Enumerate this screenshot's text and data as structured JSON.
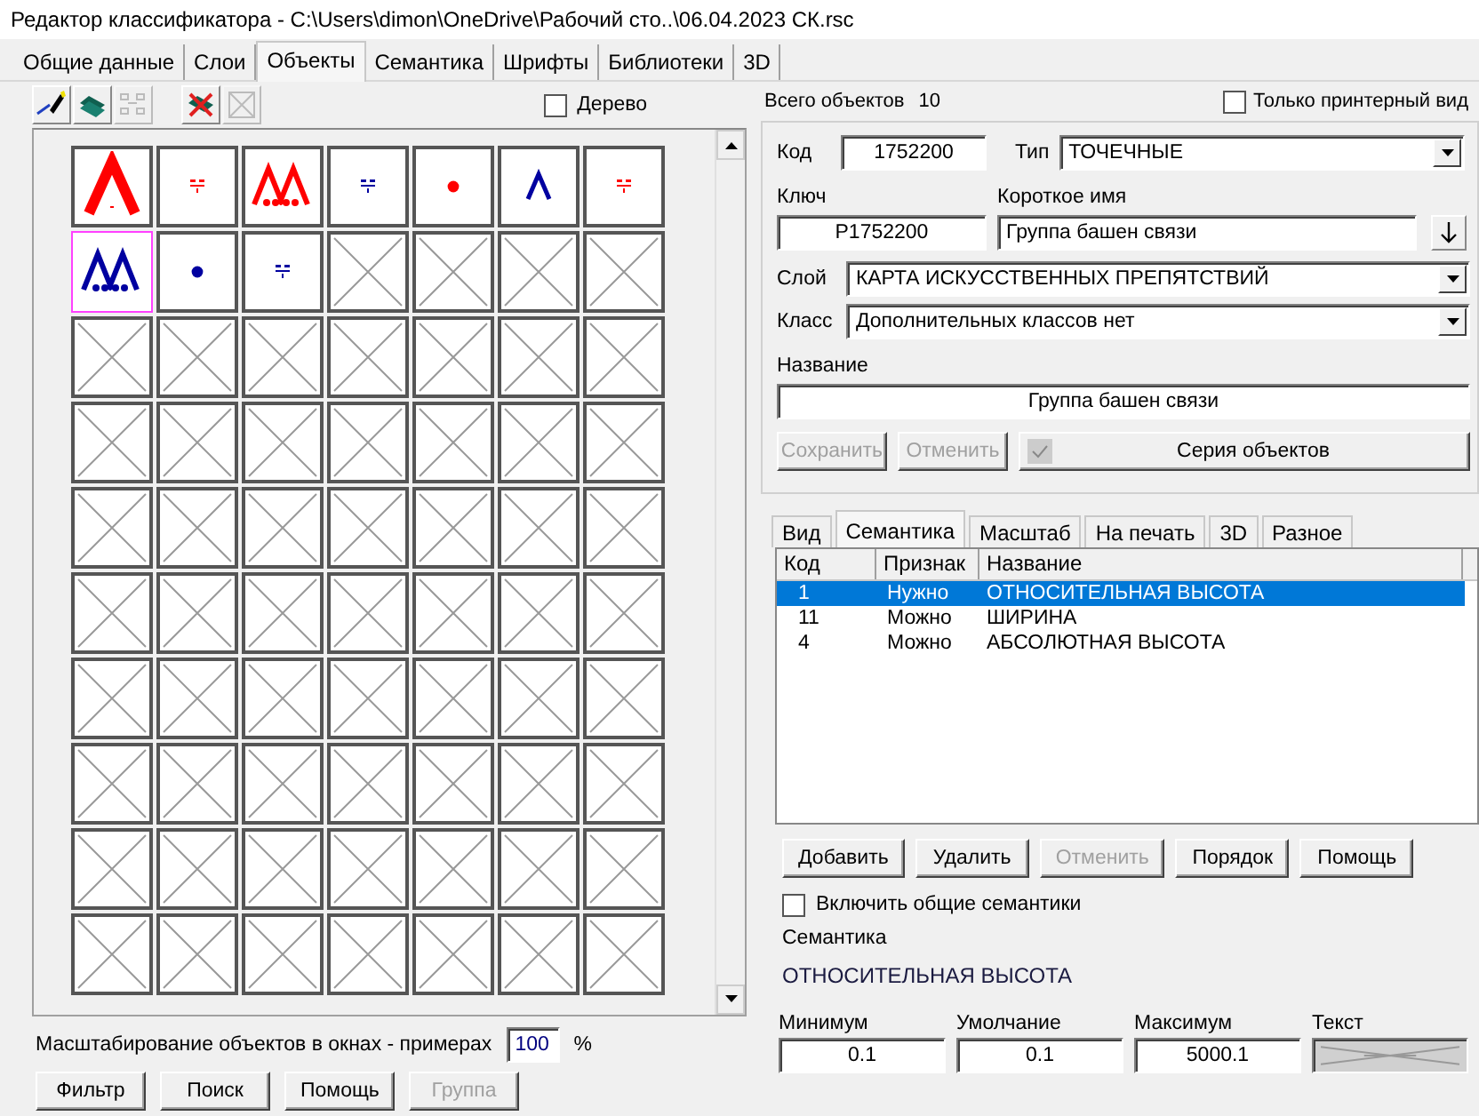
{
  "window": {
    "title": "Редактор классификатора - C:\\Users\\dimon\\OneDrive\\Рабочий сто..\\06.04.2023 СК.rsc"
  },
  "tabs": [
    {
      "label": "Общие данные",
      "selected": false
    },
    {
      "label": "Слои",
      "selected": false
    },
    {
      "label": "Объекты",
      "selected": true
    },
    {
      "label": "Семантика",
      "selected": false
    },
    {
      "label": "Шрифты",
      "selected": false
    },
    {
      "label": "Библиотеки",
      "selected": false
    },
    {
      "label": "3D",
      "selected": false
    }
  ],
  "toolbar": [
    {
      "kind": "edit",
      "disabled": false
    },
    {
      "kind": "copy",
      "disabled": false
    },
    {
      "kind": "move",
      "disabled": true
    },
    {
      "kind": "delete",
      "disabled": false
    },
    {
      "kind": "clear",
      "disabled": true
    }
  ],
  "tree_checkbox": {
    "label": "Дерево",
    "checked": false
  },
  "objects": [
    {
      "kind": "caret",
      "color": "#ff0000",
      "selected": false
    },
    {
      "kind": "fraction",
      "color": "#ff0000",
      "selected": false
    },
    {
      "kind": "double",
      "color": "#ff0000",
      "selected": false
    },
    {
      "kind": "fraction",
      "color": "#0000a0",
      "selected": false
    },
    {
      "kind": "dot",
      "color": "#ff0000",
      "selected": false
    },
    {
      "kind": "small_caret",
      "color": "#0000a0",
      "selected": false
    },
    {
      "kind": "fraction",
      "color": "#ff0000",
      "selected": false
    },
    {
      "kind": "double",
      "color": "#0000a0",
      "selected": true
    },
    {
      "kind": "dot",
      "color": "#0000a0",
      "selected": false
    },
    {
      "kind": "fraction",
      "color": "#0000a0",
      "selected": false
    }
  ],
  "scale": {
    "label": "Масштабирование объектов в окнах - примерах",
    "value": "100",
    "unit": "%"
  },
  "left_buttons": [
    {
      "label": "Фильтр",
      "disabled": false
    },
    {
      "label": "Поиск",
      "disabled": false
    },
    {
      "label": "Помощь",
      "disabled": false
    },
    {
      "label": "Группа",
      "disabled": true
    }
  ],
  "object_count": {
    "label": "Всего объектов",
    "value": "10"
  },
  "printer_view": {
    "label": "Только принтерный вид",
    "checked": false
  },
  "form": {
    "code": {
      "label": "Код",
      "value": "1752200"
    },
    "type": {
      "label": "Тип",
      "value": "ТОЧЕЧНЫЕ"
    },
    "key": {
      "label": "Ключ",
      "value": "P1752200"
    },
    "short_name": {
      "label": "Короткое имя",
      "value": "Группа башен связи"
    },
    "layer": {
      "label": "Слой",
      "value": "КАРТА ИСКУССТВЕННЫХ ПРЕПЯТСТВИЙ"
    },
    "class": {
      "label": "Класс",
      "value": "Дополнительных классов нет"
    },
    "name": {
      "label": "Название",
      "value": "Группа башен связи"
    },
    "buttons": [
      {
        "label": "Сохранить",
        "disabled": true
      },
      {
        "label": "Отменить",
        "disabled": true
      }
    ],
    "series": {
      "label": "Серия объектов"
    }
  },
  "sub_tabs": [
    {
      "label": "Вид",
      "selected": false
    },
    {
      "label": "Семантика",
      "selected": true
    },
    {
      "label": "Масштаб",
      "selected": false
    },
    {
      "label": "На печать",
      "selected": false
    },
    {
      "label": "3D",
      "selected": false
    },
    {
      "label": "Разное",
      "selected": false
    }
  ],
  "semantics_table": {
    "columns": [
      "Код",
      "Признак",
      "Название"
    ],
    "rows": [
      {
        "code": "1",
        "sign": "Нужно",
        "name": "ОТНОСИТЕЛЬНАЯ ВЫСОТА",
        "selected": true
      },
      {
        "code": "11",
        "sign": "Можно",
        "name": "ШИРИНА",
        "selected": false
      },
      {
        "code": "4",
        "sign": "Можно",
        "name": "АБСОЛЮТНАЯ ВЫСОТА",
        "selected": false
      }
    ]
  },
  "semantic_buttons": [
    {
      "label": "Добавить",
      "disabled": false
    },
    {
      "label": "Удалить",
      "disabled": false
    },
    {
      "label": "Отменить",
      "disabled": true
    },
    {
      "label": "Порядок",
      "disabled": false
    },
    {
      "label": "Помощь",
      "disabled": false
    }
  ],
  "common_semantics": {
    "label": "Включить общие семантики",
    "checked": false
  },
  "semantic": {
    "label": "Семантика",
    "value": "ОТНОСИТЕЛЬНАЯ ВЫСОТА"
  },
  "limits": [
    {
      "label": "Минимум",
      "value": "0.1"
    },
    {
      "label": "Умолчание",
      "value": "0.1"
    },
    {
      "label": "Максимум",
      "value": "5000.1"
    }
  ],
  "text_field": {
    "label": "Текст"
  }
}
